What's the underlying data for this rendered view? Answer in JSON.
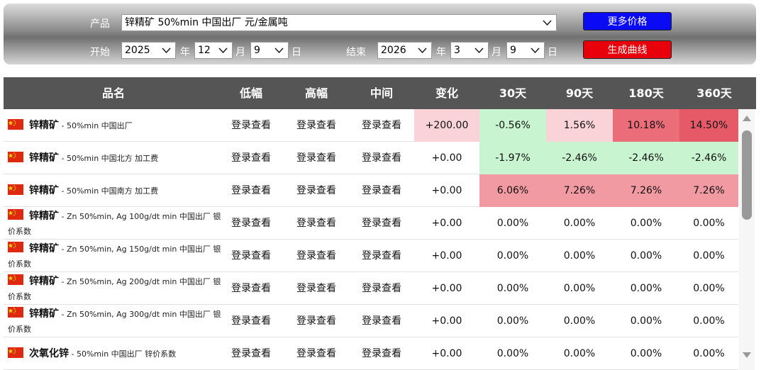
{
  "controls": {
    "product_label": "产品",
    "product_value": "锌精矿 50%min 中国出厂 元/金属吨",
    "start_label": "开始",
    "end_label": "结束",
    "start": {
      "year": "2025",
      "month": "12",
      "day": "9"
    },
    "end": {
      "year": "2026",
      "month": "3",
      "day": "9"
    },
    "year_unit": "年",
    "month_unit": "月",
    "day_unit": "日",
    "more_prices_label": "更多价格",
    "generate_curve_label": "生成曲线"
  },
  "colors": {
    "button_blue": "#0a0af5",
    "button_red": "#e8000b",
    "header_bg": "#555555",
    "up_strong": "#e65a68",
    "up_medium": "#f29aa2",
    "up_light": "#f9d3d7",
    "down_light": "#c8f5d0"
  },
  "table": {
    "headers": [
      "品名",
      "低幅",
      "高幅",
      "中间",
      "变化",
      "30天",
      "90天",
      "180天",
      "360天"
    ],
    "rows": [
      {
        "name": "锌精矿",
        "spec": " - ",
        "desc": "50%min 中国出厂",
        "desc2": "",
        "low": "登录查看",
        "high": "登录查看",
        "mid": "登录查看",
        "change": "+200.00",
        "d30": "-0.56%",
        "d90": "1.56%",
        "d180": "10.18%",
        "d360": "14.50%"
      },
      {
        "name": "锌精矿",
        "spec": " - ",
        "desc": "50%min 中国北方 加工费",
        "desc2": "",
        "low": "登录查看",
        "high": "登录查看",
        "mid": "登录查看",
        "change": "+0.00",
        "d30": "-1.97%",
        "d90": "-2.46%",
        "d180": "-2.46%",
        "d360": "-2.46%"
      },
      {
        "name": "锌精矿",
        "spec": " - ",
        "desc": "50%min 中国南方 加工费",
        "desc2": "",
        "low": "登录查看",
        "high": "登录查看",
        "mid": "登录查看",
        "change": "+0.00",
        "d30": "6.06%",
        "d90": "7.26%",
        "d180": "7.26%",
        "d360": "7.26%"
      },
      {
        "name": "锌精矿",
        "spec": " - ",
        "desc": "Zn 50%min, Ag 100g/dt min 中国出厂 银",
        "desc2": "价系数",
        "low": "登录查看",
        "high": "登录查看",
        "mid": "登录查看",
        "change": "+0.00",
        "d30": "0.00%",
        "d90": "0.00%",
        "d180": "0.00%",
        "d360": "0.00%"
      },
      {
        "name": "锌精矿",
        "spec": " - ",
        "desc": "Zn 50%min, Ag 150g/dt min 中国出厂 银",
        "desc2": "价系数",
        "low": "登录查看",
        "high": "登录查看",
        "mid": "登录查看",
        "change": "+0.00",
        "d30": "0.00%",
        "d90": "0.00%",
        "d180": "0.00%",
        "d360": "0.00%"
      },
      {
        "name": "锌精矿",
        "spec": " - ",
        "desc": "Zn 50%min, Ag 200g/dt min 中国出厂 银",
        "desc2": "价系数",
        "low": "登录查看",
        "high": "登录查看",
        "mid": "登录查看",
        "change": "+0.00",
        "d30": "0.00%",
        "d90": "0.00%",
        "d180": "0.00%",
        "d360": "0.00%"
      },
      {
        "name": "锌精矿",
        "spec": " - ",
        "desc": "Zn 50%min, Ag 300g/dt min 中国出厂 银",
        "desc2": "价系数",
        "low": "登录查看",
        "high": "登录查看",
        "mid": "登录查看",
        "change": "+0.00",
        "d30": "0.00%",
        "d90": "0.00%",
        "d180": "0.00%",
        "d360": "0.00%"
      },
      {
        "name": "次氧化锌",
        "spec": " - ",
        "desc": "50%min 中国出厂 锌价系数",
        "desc2": "",
        "low": "登录查看",
        "high": "登录查看",
        "mid": "登录查看",
        "change": "+0.00",
        "d30": "0.00%",
        "d90": "0.00%",
        "d180": "0.00%",
        "d360": "0.00%"
      }
    ]
  }
}
